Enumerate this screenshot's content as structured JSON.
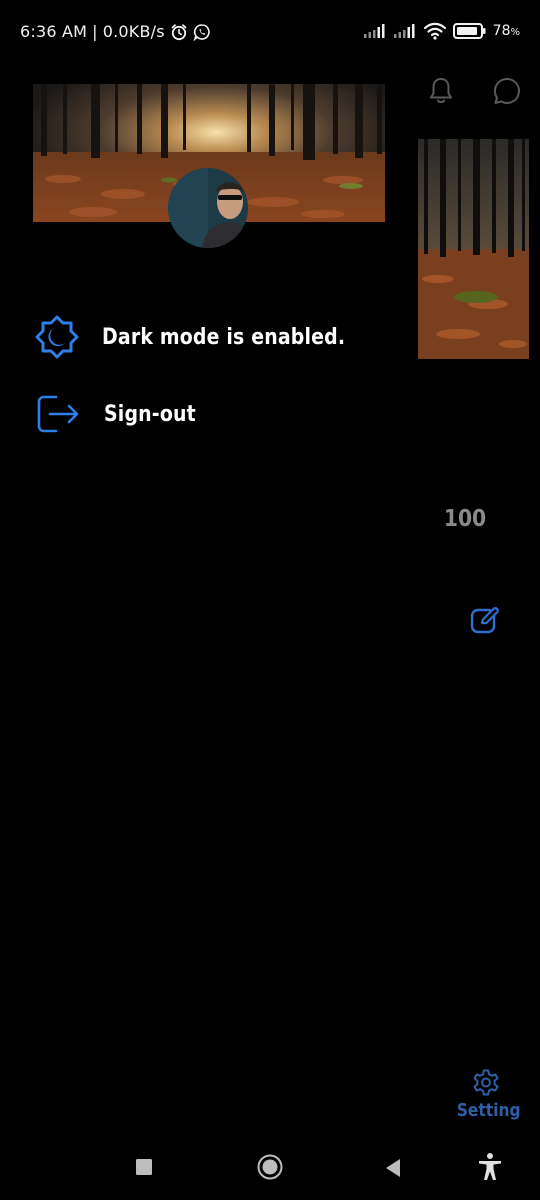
{
  "status_bar": {
    "time": "6:36 AM",
    "separator": "|",
    "speed": "0.0KB/s",
    "battery": "78",
    "battery_unit": "%",
    "icons": [
      "alarm-icon",
      "whatsapp-icon",
      "signal-icon",
      "signal-icon",
      "wifi-icon",
      "battery-icon"
    ]
  },
  "header": {
    "icons": [
      "bell-icon",
      "chat-icon"
    ]
  },
  "menu": {
    "dark_mode_label": "Dark mode is enabled.",
    "signout_label": "Sign-out"
  },
  "content": {
    "count": "100"
  },
  "bottom": {
    "setting_label": "Setting"
  },
  "colors": {
    "background": "#000000",
    "accent": "#2f7fe8",
    "setting_accent": "#2f5fa6",
    "muted_text": "#8a8a8a"
  },
  "nav_bar": {
    "icons": [
      "recents-icon",
      "home-icon",
      "back-icon",
      "accessibility-icon"
    ]
  }
}
